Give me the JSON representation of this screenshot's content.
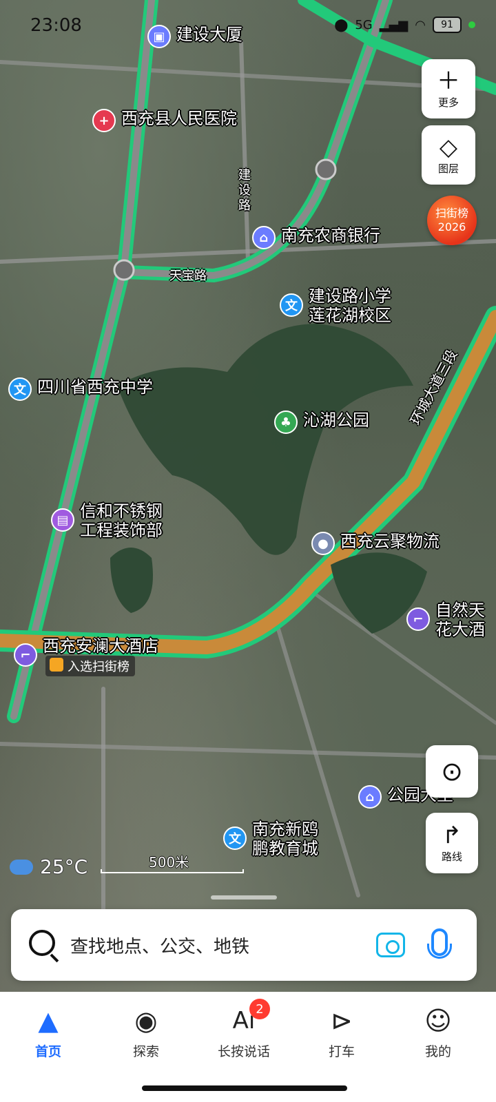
{
  "status": {
    "time": "23:08",
    "network": "5G",
    "battery": "91"
  },
  "map": {
    "pois": [
      {
        "id": "jianshe-building",
        "label": "建设大厦",
        "icon": "building-icon",
        "color": "#6b7cff"
      },
      {
        "id": "hospital",
        "label": "西充县人民医院",
        "icon": "hospital-icon",
        "color": "#e53950"
      },
      {
        "id": "bank",
        "label": "南充农商银行",
        "icon": "bank-icon",
        "color": "#6b7cff"
      },
      {
        "id": "school1",
        "label": "建设路小学\n莲花湖校区",
        "icon": "school-icon",
        "color": "#2196f3"
      },
      {
        "id": "school2",
        "label": "四川省西充中学",
        "icon": "school-icon",
        "color": "#2196f3"
      },
      {
        "id": "park",
        "label": "沁湖公园",
        "icon": "park-icon",
        "color": "#34a853"
      },
      {
        "id": "shop",
        "label": "信和不锈钢\n工程装饰部",
        "icon": "shop-icon",
        "color": "#a05be0"
      },
      {
        "id": "logistics",
        "label": "西充云聚物流",
        "icon": "poi-dot-icon",
        "color": "#7a8ab0"
      },
      {
        "id": "hotel1",
        "label": "西充安澜大酒店",
        "icon": "hotel-icon",
        "color": "#7e5be0"
      },
      {
        "id": "hotel2",
        "label": "自然天\n花大酒",
        "icon": "hotel-icon",
        "color": "#7e5be0"
      },
      {
        "id": "park2",
        "label": "公园大里",
        "icon": "building-icon",
        "color": "#6b7cff"
      },
      {
        "id": "edu",
        "label": "南充新鸥\n鹏教育城",
        "icon": "school-icon",
        "color": "#2196f3"
      }
    ],
    "road_labels": {
      "jianshe_road": "建\n设\n路",
      "tianbao_road": "天宝路",
      "ring_road": "环城大道三段"
    },
    "tag_chip": "入选扫街榜",
    "scale": "500米",
    "weather": {
      "temp": "25°C",
      "icon": "cloud-icon"
    }
  },
  "controls": {
    "more": "更多",
    "layers": "图层",
    "badge_line1": "扫街榜",
    "badge_line2": "2026",
    "route": "路线"
  },
  "search": {
    "placeholder": "查找地点、公交、地铁"
  },
  "tabs": [
    {
      "label": "首页",
      "icon": "navigation-arrow-icon",
      "active": true
    },
    {
      "label": "探索",
      "icon": "location-pin-icon"
    },
    {
      "label": "长按说话",
      "icon": "ai-icon",
      "glyph": "Ai",
      "badge": "2"
    },
    {
      "label": "打车",
      "icon": "taxi-icon"
    },
    {
      "label": "我的",
      "icon": "profile-icon"
    }
  ],
  "colors": {
    "accent": "#1e6cff",
    "road_green": "#22c97a",
    "ring_road": "#c98a3a"
  }
}
